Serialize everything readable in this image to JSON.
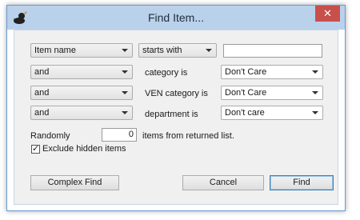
{
  "window": {
    "title": "Find Item...",
    "close_label": "✕"
  },
  "row1": {
    "field_select": "Item name",
    "operator_select": "starts with",
    "search_value": ""
  },
  "row2": {
    "conj": "and",
    "label": "category is",
    "value": "Don't Care"
  },
  "row3": {
    "conj": "and",
    "label": "VEN category is",
    "value": "Don't Care"
  },
  "row4": {
    "conj": "and",
    "label": "department is",
    "value": "Don't care"
  },
  "random": {
    "label": "Randomly",
    "count": "0",
    "suffix": "items from returned list."
  },
  "exclude_hidden": {
    "label": "Exclude hidden items",
    "checked": true
  },
  "buttons": {
    "complex_find": "Complex Find",
    "cancel": "Cancel",
    "find": "Find"
  }
}
